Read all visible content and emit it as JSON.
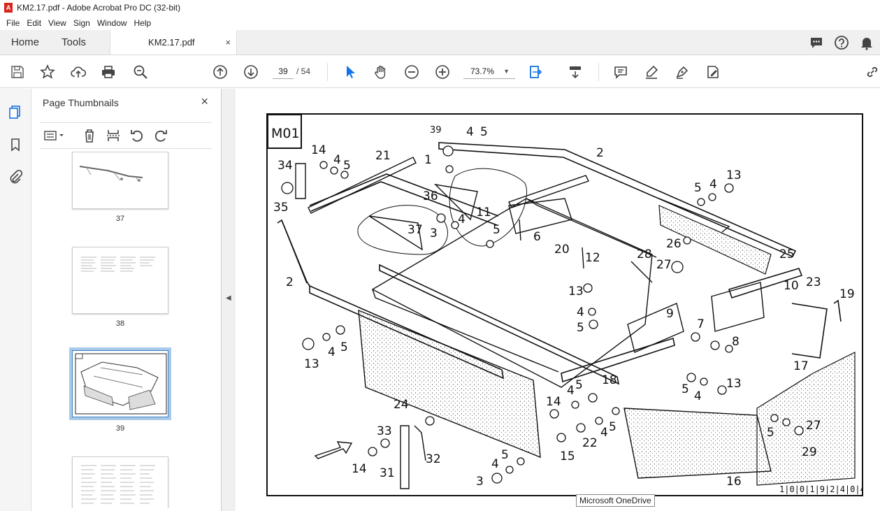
{
  "window": {
    "title": "KM2.17.pdf - Adobe Acrobat Pro DC (32-bit)"
  },
  "menu": [
    "File",
    "Edit",
    "View",
    "Sign",
    "Window",
    "Help"
  ],
  "tabs": {
    "home": "Home",
    "tools": "Tools",
    "document": "KM2.17.pdf",
    "close_glyph": "×"
  },
  "toolbar": {
    "current_page": "39",
    "page_total": "/ 54",
    "zoom": "73.7%"
  },
  "panel": {
    "title": "Page Thumbnails",
    "close_glyph": "×"
  },
  "thumbnails": [
    {
      "label": "37"
    },
    {
      "label": "38"
    },
    {
      "label": "39",
      "selected": true
    },
    {
      "label": ""
    }
  ],
  "drawing": {
    "code": "M01",
    "catalog_number": "1|0|0|1|9|2|4|0|4",
    "part_labels": [
      "1",
      "2",
      "2",
      "3",
      "3",
      "4",
      "4",
      "4",
      "4",
      "4",
      "4",
      "4",
      "4",
      "4",
      "4",
      "5",
      "5",
      "5",
      "5",
      "5",
      "5",
      "5",
      "5",
      "5",
      "5",
      "5",
      "6",
      "7",
      "8",
      "9",
      "10",
      "11",
      "12",
      "13",
      "13",
      "13",
      "13",
      "14",
      "14",
      "14",
      "15",
      "16",
      "17",
      "18",
      "19",
      "20",
      "21",
      "22",
      "23",
      "24",
      "25",
      "26",
      "27",
      "27",
      "28",
      "29",
      "31",
      "32",
      "33",
      "34",
      "35",
      "36",
      "37",
      "39"
    ]
  },
  "tooltip": "Microsoft OneDrive",
  "colors": {
    "accent": "#1473e6",
    "selection": "#a9c9e8"
  }
}
